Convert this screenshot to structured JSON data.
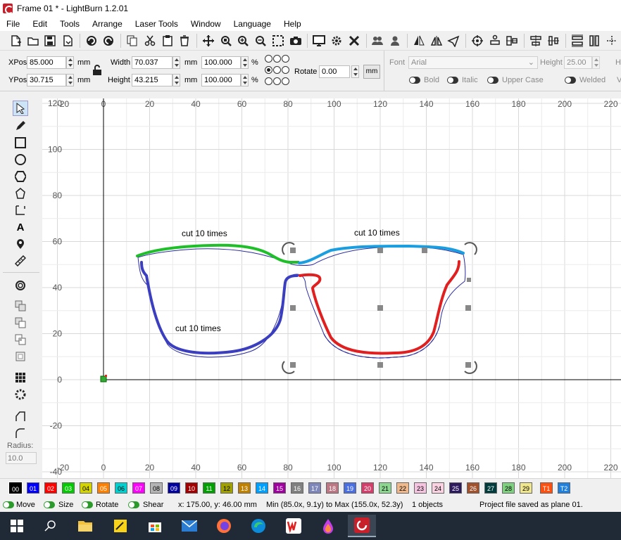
{
  "window": {
    "title": "Frame 01 * - LightBurn 1.2.01"
  },
  "menu": [
    "File",
    "Edit",
    "Tools",
    "Arrange",
    "Laser Tools",
    "Window",
    "Language",
    "Help"
  ],
  "toolbar_icons": [
    "new-file-icon",
    "open-file-icon",
    "save-icon",
    "import-icon",
    "undo-icon",
    "redo-icon",
    "copy-icon",
    "cut-icon",
    "paste-icon",
    "delete-icon",
    "move-icon",
    "zoom-fit-icon",
    "zoom-in-icon",
    "zoom-out-icon",
    "zoom-selection-icon",
    "camera-icon",
    "monitor-icon",
    "settings-icon",
    "tools-icon",
    "group-icon",
    "ungroup-icon",
    "mirror-horizontal-icon",
    "mirror-vertical-icon",
    "send-icon",
    "center-laser-icon",
    "align-left-icon",
    "align-center-icon",
    "align-right-icon",
    "align-top-icon",
    "distribute-icon",
    "distribute-vertical-icon"
  ],
  "props": {
    "xpos_label": "XPos",
    "xpos": "85.000",
    "ypos_label": "YPos",
    "ypos": "30.715",
    "unit": "mm",
    "width_label": "Width",
    "width": "70.037",
    "height_label": "Height",
    "height": "43.215",
    "scale_w": "100.000",
    "scale_h": "100.000",
    "percent": "%",
    "rotate_label": "Rotate",
    "rotate": "0.00",
    "rotate_unit": "mm",
    "font_label": "Font",
    "font": "Arial",
    "font_height_label": "Height",
    "font_height": "25.00",
    "h_label": "H",
    "bold": "Bold",
    "italic": "Italic",
    "upper_case": "Upper Case",
    "welded": "Welded",
    "v_label": "V"
  },
  "left_tools": [
    "select-icon",
    "draw-pen-icon",
    "rectangle-icon",
    "ellipse-icon",
    "polygon-icon",
    "edit-nodes-icon",
    "position-icon",
    "text-icon",
    "marker-icon",
    "measure-icon",
    "offset-icon",
    "boolean-union-icon",
    "boolean-subtract-icon",
    "boolean-intersect-icon",
    "weld-icon",
    "grid-array-icon",
    "circular-array-icon",
    "corner-round-icon",
    "corner-chamfer-icon"
  ],
  "radius": {
    "label": "Radius:",
    "value": "10.0"
  },
  "canvas": {
    "x_ticks": [
      "0",
      "20",
      "40",
      "60",
      "80",
      "100",
      "120",
      "140",
      "160",
      "180",
      "200",
      "220"
    ],
    "top_x_first": "-20",
    "bottom_x_first": "-20",
    "y_ticks": [
      "120",
      "100",
      "80",
      "60",
      "40",
      "20",
      "0",
      "-20",
      "-40"
    ],
    "y_top_label": "120",
    "labels": {
      "left_top": "cut 10 times",
      "right_top": "cut 10 times",
      "left_bottom": "cut 10 times"
    },
    "colors": {
      "green": "#1fbf2a",
      "blue_light": "#1a9ee0",
      "blue_dark": "#3b3fbf",
      "red": "#e02020",
      "outline": "#2a2aa0"
    }
  },
  "palette": [
    {
      "label": "00",
      "color": "#000000"
    },
    {
      "label": "01",
      "color": "#0000ff"
    },
    {
      "label": "02",
      "color": "#ff0000"
    },
    {
      "label": "03",
      "color": "#00cc00"
    },
    {
      "label": "04",
      "color": "#d4d400"
    },
    {
      "label": "05",
      "color": "#ff8000"
    },
    {
      "label": "06",
      "color": "#00d0d0"
    },
    {
      "label": "07",
      "color": "#ff00ff"
    },
    {
      "label": "08",
      "color": "#b4b4b4"
    },
    {
      "label": "09",
      "color": "#0000a0"
    },
    {
      "label": "10",
      "color": "#a00000"
    },
    {
      "label": "11",
      "color": "#00a000"
    },
    {
      "label": "12",
      "color": "#a0a000"
    },
    {
      "label": "13",
      "color": "#c08000"
    },
    {
      "label": "14",
      "color": "#00a0ff"
    },
    {
      "label": "15",
      "color": "#a000a0"
    },
    {
      "label": "16",
      "color": "#808080"
    },
    {
      "label": "17",
      "color": "#7d87b9"
    },
    {
      "label": "18",
      "color": "#bb7784"
    },
    {
      "label": "19",
      "color": "#4a6fe3"
    },
    {
      "label": "20",
      "color": "#d33f6a"
    },
    {
      "label": "21",
      "color": "#8cd78f"
    },
    {
      "label": "22",
      "color": "#f0b98d"
    },
    {
      "label": "23",
      "color": "#f6c4e1"
    },
    {
      "label": "24",
      "color": "#fad2e1"
    },
    {
      "label": "25",
      "color": "#2d1a5e"
    },
    {
      "label": "26",
      "color": "#a0522d"
    },
    {
      "label": "27",
      "color": "#003c3c"
    },
    {
      "label": "28",
      "color": "#7fd07f"
    },
    {
      "label": "29",
      "color": "#f0e68c"
    },
    {
      "label": "T1",
      "color": "#ff5010"
    },
    {
      "label": "T2",
      "color": "#2080e0"
    }
  ],
  "status": {
    "move": "Move",
    "size": "Size",
    "rotate": "Rotate",
    "shear": "Shear",
    "coords": "x: 175.00, y: 46.00 mm",
    "bounds": "Min (85.0x, 9.1y) to Max (155.0x, 52.3y)",
    "objects": "1 objects",
    "message": "Project file saved as plane 01."
  },
  "taskbar": [
    "windows-start-icon",
    "search-icon",
    "file-explorer-icon",
    "sticky-notes-icon",
    "store-icon",
    "mail-icon",
    "firefox-icon",
    "edge-icon",
    "wps-office-icon",
    "paint-icon",
    "lightburn-icon"
  ]
}
